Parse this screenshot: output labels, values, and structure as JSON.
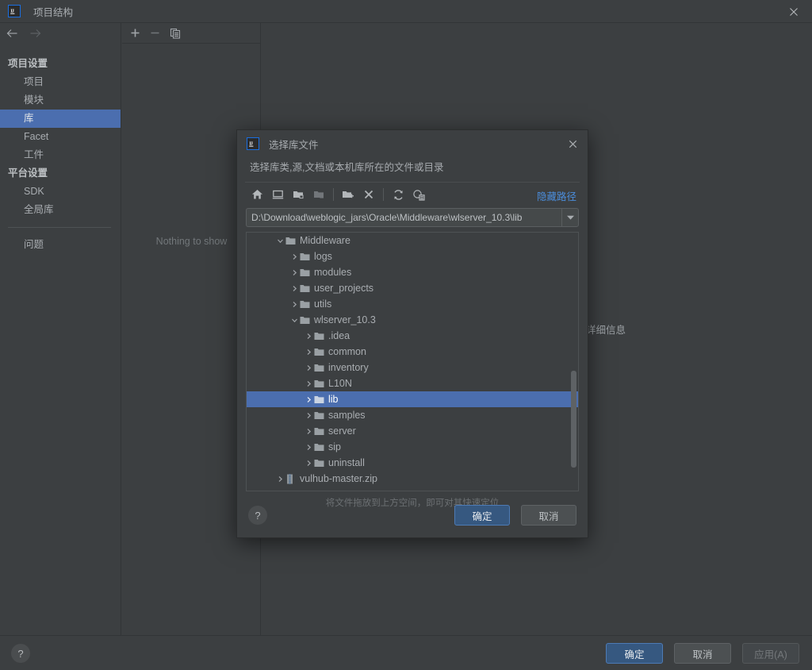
{
  "window": {
    "title": "项目结构",
    "logo_text": "IJ",
    "close_icon": "close-icon"
  },
  "sidebar": {
    "back_icon": "arrow-left-icon",
    "forward_icon": "arrow-right-icon",
    "sections": [
      {
        "type": "group",
        "label": "项目设置"
      },
      {
        "type": "item",
        "label": "项目",
        "selected": false
      },
      {
        "type": "item",
        "label": "模块",
        "selected": false
      },
      {
        "type": "item",
        "label": "库",
        "selected": true
      },
      {
        "type": "item",
        "label": "Facet",
        "selected": false
      },
      {
        "type": "item",
        "label": "工件",
        "selected": false
      },
      {
        "type": "group",
        "label": "平台设置"
      },
      {
        "type": "item",
        "label": "SDK",
        "selected": false
      },
      {
        "type": "item",
        "label": "全局库",
        "selected": false
      },
      {
        "type": "divider",
        "label": ""
      },
      {
        "type": "item",
        "label": "问题",
        "selected": false
      }
    ]
  },
  "center_panel": {
    "toolbar": [
      {
        "name": "add-button",
        "label": "+"
      },
      {
        "name": "remove-button",
        "label": "−"
      },
      {
        "name": "copy-button",
        "label": "copy-icon"
      }
    ],
    "empty_text": "Nothing to show"
  },
  "right_panel": {
    "details_label": "详细信息"
  },
  "bottom_bar": {
    "help_label": "?",
    "buttons": [
      {
        "name": "ok-button",
        "label": "确定",
        "style": "primary"
      },
      {
        "name": "cancel-button",
        "label": "取消",
        "style": "normal"
      },
      {
        "name": "apply-button",
        "label": "应用(A)",
        "style": "disabled"
      }
    ]
  },
  "dialog": {
    "logo_text": "IJ",
    "title": "选择库文件",
    "close_icon": "close-icon",
    "subtitle": "选择库类,源,文档或本机库所在的文件或目录",
    "toolbar": [
      {
        "name": "home-icon",
        "dim": false
      },
      {
        "name": "desktop-icon",
        "dim": false
      },
      {
        "name": "project-folder-icon",
        "dim": false
      },
      {
        "name": "module-folder-icon",
        "dim": true
      },
      {
        "name": "new-folder-icon",
        "dim": false
      },
      {
        "name": "delete-icon",
        "dim": false
      },
      {
        "name": "refresh-icon",
        "dim": false
      },
      {
        "name": "show-hidden-icon",
        "dim": false
      }
    ],
    "hide_path_label": "隐藏路径",
    "path_value": "D:\\Download\\weblogic_jars\\Oracle\\Middleware\\wlserver_10.3\\lib",
    "path_dropdown_icon": "chevron-down-icon",
    "tree": [
      {
        "label": "Middleware",
        "depth": 2,
        "state": "expanded",
        "icon": "folder",
        "selected": false
      },
      {
        "label": "logs",
        "depth": 3,
        "state": "collapsed",
        "icon": "folder",
        "selected": false
      },
      {
        "label": "modules",
        "depth": 3,
        "state": "collapsed",
        "icon": "folder",
        "selected": false
      },
      {
        "label": "user_projects",
        "depth": 3,
        "state": "collapsed",
        "icon": "folder",
        "selected": false
      },
      {
        "label": "utils",
        "depth": 3,
        "state": "collapsed",
        "icon": "folder",
        "selected": false
      },
      {
        "label": "wlserver_10.3",
        "depth": 3,
        "state": "expanded",
        "icon": "folder",
        "selected": false
      },
      {
        "label": ".idea",
        "depth": 4,
        "state": "collapsed",
        "icon": "folder",
        "selected": false
      },
      {
        "label": "common",
        "depth": 4,
        "state": "collapsed",
        "icon": "folder",
        "selected": false
      },
      {
        "label": "inventory",
        "depth": 4,
        "state": "collapsed",
        "icon": "folder",
        "selected": false
      },
      {
        "label": "L10N",
        "depth": 4,
        "state": "collapsed",
        "icon": "folder",
        "selected": false
      },
      {
        "label": "lib",
        "depth": 4,
        "state": "collapsed",
        "icon": "folder",
        "selected": true
      },
      {
        "label": "samples",
        "depth": 4,
        "state": "collapsed",
        "icon": "folder",
        "selected": false
      },
      {
        "label": "server",
        "depth": 4,
        "state": "collapsed",
        "icon": "folder",
        "selected": false
      },
      {
        "label": "sip",
        "depth": 4,
        "state": "collapsed",
        "icon": "folder",
        "selected": false
      },
      {
        "label": "uninstall",
        "depth": 4,
        "state": "collapsed",
        "icon": "folder",
        "selected": false
      },
      {
        "label": "vulhub-master.zip",
        "depth": 2,
        "state": "collapsed",
        "icon": "archive",
        "selected": false
      },
      {
        "label": "",
        "depth": 2,
        "state": "collapsed",
        "icon": "folder",
        "selected": false
      }
    ],
    "drop_hint": "将文件拖放到上方空间，即可对其快速定位",
    "help_label": "?",
    "buttons": [
      {
        "name": "dialog-ok-button",
        "label": "确定",
        "style": "primary"
      },
      {
        "name": "dialog-cancel-button",
        "label": "取消",
        "style": "normal"
      }
    ]
  },
  "colors": {
    "background": "#3c3f41",
    "selection_blue": "#4b6eaf",
    "primary_button": "#365880",
    "link_blue": "#4b8ddb",
    "text": "#a9adb1"
  }
}
